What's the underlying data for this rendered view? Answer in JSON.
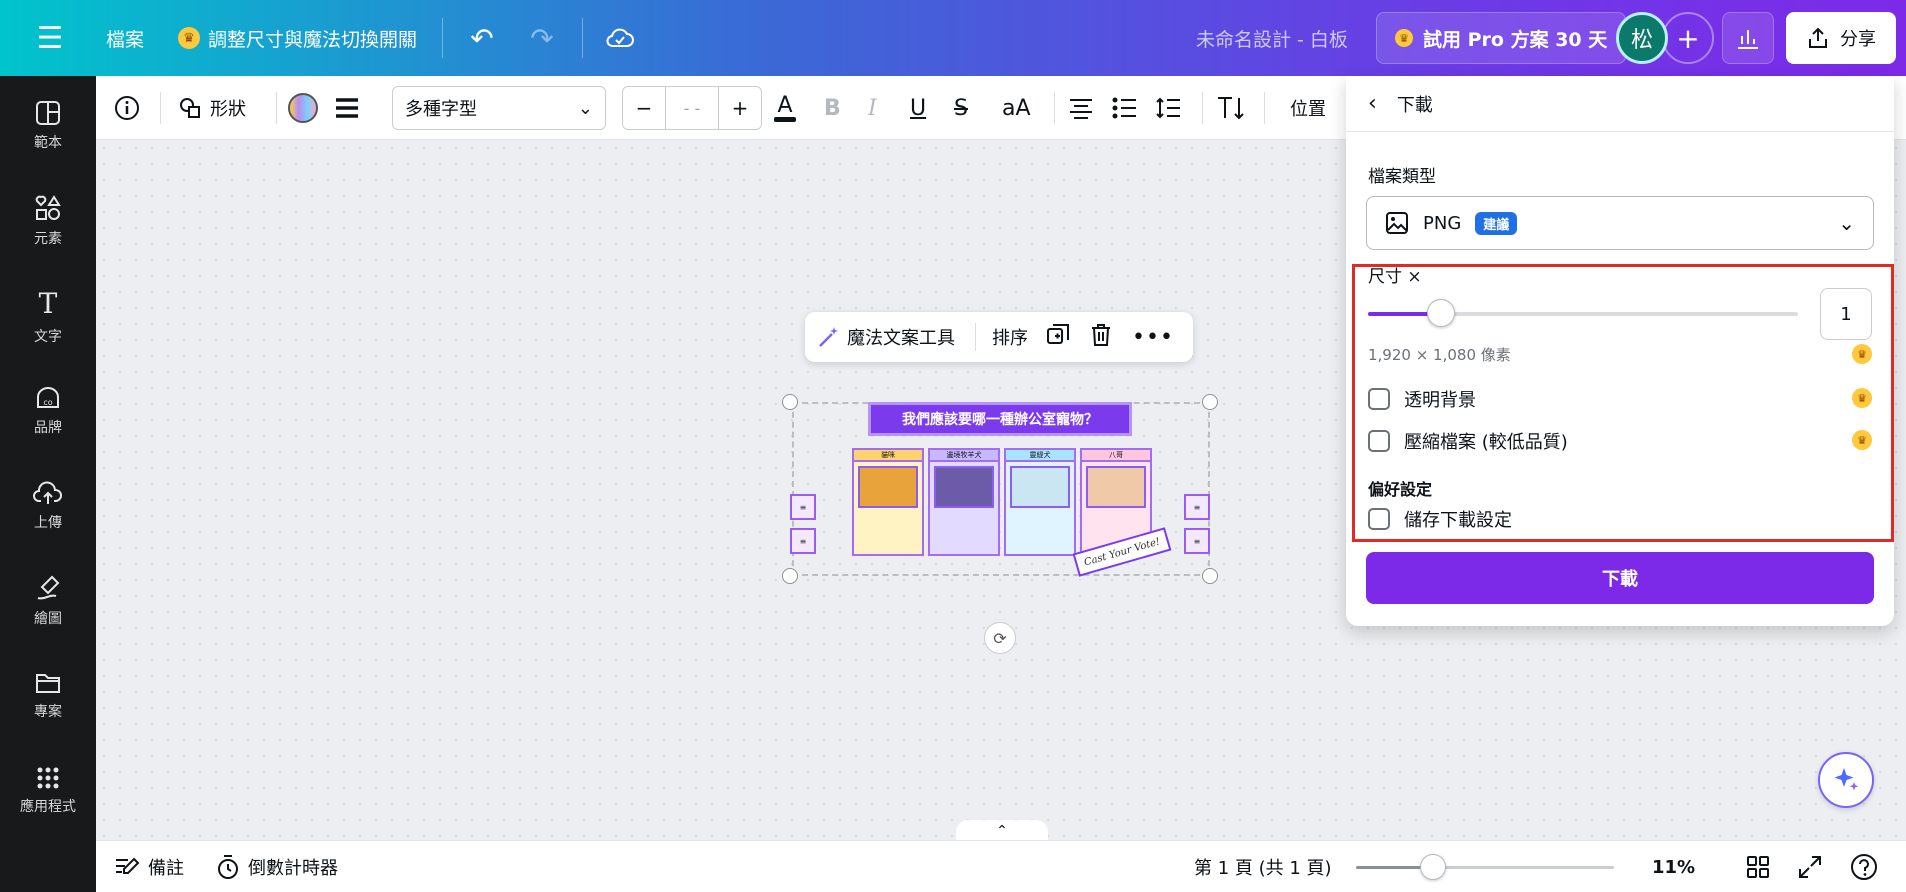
{
  "topbar": {
    "file_label": "檔案",
    "resize_label": "調整尺寸與魔法切換開關",
    "design_title": "未命名設計 - 白板",
    "pro_trial_label": "試用 Pro 方案 30 天",
    "avatar_initial": "松",
    "share_label": "分享"
  },
  "sidebar": {
    "items": [
      {
        "label": "範本",
        "icon": "template-icon"
      },
      {
        "label": "元素",
        "icon": "elements-icon"
      },
      {
        "label": "文字",
        "icon": "text-icon"
      },
      {
        "label": "品牌",
        "icon": "brand-icon"
      },
      {
        "label": "上傳",
        "icon": "upload-icon"
      },
      {
        "label": "繪圖",
        "icon": "draw-icon"
      },
      {
        "label": "專案",
        "icon": "folder-icon"
      },
      {
        "label": "應用程式",
        "icon": "apps-icon"
      }
    ]
  },
  "toolbar": {
    "shape_label": "形狀",
    "font_name": "多種字型",
    "font_size_value": "- -",
    "case_label": "aA",
    "position_label": "位置"
  },
  "canvas": {
    "float_bar": {
      "magic_write_label": "魔法文案工具",
      "arrange_label": "排序"
    },
    "board_title": "我們應該要哪一種辦公室寵物？",
    "columns": [
      {
        "header": "貓咪",
        "color": "#ffd36b"
      },
      {
        "header": "邊境牧羊犬",
        "color": "#c8b8ff"
      },
      {
        "header": "靈緹犬",
        "color": "#a8e4ff"
      },
      {
        "header": "八哥",
        "color": "#ffc6dd"
      }
    ],
    "signature_text": "Cast Your Vote!"
  },
  "bottombar": {
    "notes_label": "備註",
    "timer_label": "倒數計時器",
    "page_info": "第 1 頁 (共 1 頁)",
    "zoom_value": "11%",
    "zoom_fraction": 0.3
  },
  "download_panel": {
    "title": "下載",
    "file_type_label": "檔案類型",
    "file_type_value": "PNG",
    "file_type_badge": "建議",
    "size_label": "尺寸 ×",
    "size_scale_value": "1",
    "size_slider_fraction": 0.17,
    "dimensions_text": "1,920 × 1,080 像素",
    "transparent_bg_label": "透明背景",
    "compress_label": "壓縮檔案 (較低品質)",
    "preferences_label": "偏好設定",
    "save_settings_label": "儲存下載設定",
    "download_button": "下載"
  },
  "colors": {
    "accent": "#7d2ae8",
    "highlight_border": "#e02a2a",
    "badge": "#1f6fe5"
  }
}
